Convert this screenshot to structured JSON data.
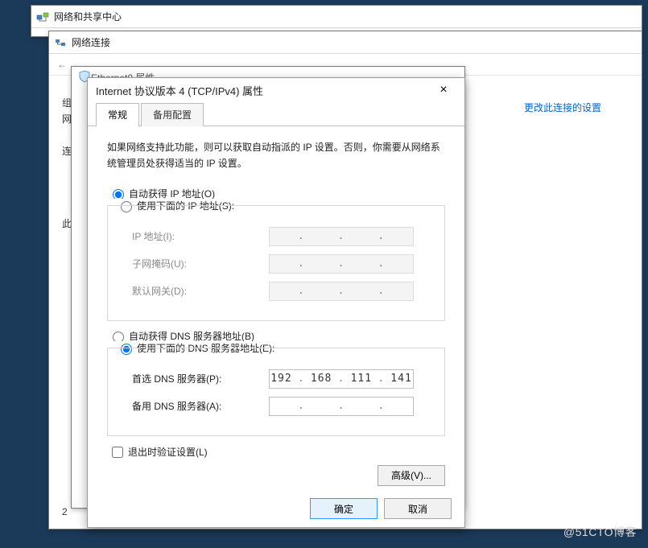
{
  "bg_windows": {
    "win1_title": "网络和共享中心",
    "win2_title": "网络连接",
    "win2_toolbar_back": "←",
    "win2_side_link": "更改此连接的设置",
    "win2_left_label1": "组",
    "win2_left_label2": "网",
    "win2_left_label3": "连",
    "win2_left_label4": "此",
    "win2_left_label5": "2",
    "win3_title": "Ethernet0 属性"
  },
  "dialog": {
    "title": "Internet 协议版本 4 (TCP/IPv4) 属性",
    "tabs": {
      "general": "常规",
      "alternate": "备用配置"
    },
    "description": "如果网络支持此功能，则可以获取自动指派的 IP 设置。否则，你需要从网络系统管理员处获得适当的 IP 设置。",
    "ip": {
      "auto": "自动获得 IP 地址(O)",
      "manual": "使用下面的 IP 地址(S):",
      "ip_label": "IP 地址(I):",
      "mask_label": "子网掩码(U):",
      "gateway_label": "默认网关(D):",
      "ip_value": "",
      "mask_value": "",
      "gateway_value": "",
      "selected": "auto"
    },
    "dns": {
      "auto": "自动获得 DNS 服务器地址(B)",
      "manual": "使用下面的 DNS 服务器地址(E):",
      "preferred_label": "首选 DNS 服务器(P):",
      "alternate_label": "备用 DNS 服务器(A):",
      "preferred_value": [
        "192",
        "168",
        "111",
        "141"
      ],
      "alternate_value": [
        "",
        "",
        "",
        ""
      ],
      "selected": "manual"
    },
    "validate_label": "退出时验证设置(L)",
    "validate_checked": false,
    "advanced_button": "高级(V)...",
    "ok_button": "确定",
    "cancel_button": "取消"
  },
  "watermark": "@51CTO博客"
}
